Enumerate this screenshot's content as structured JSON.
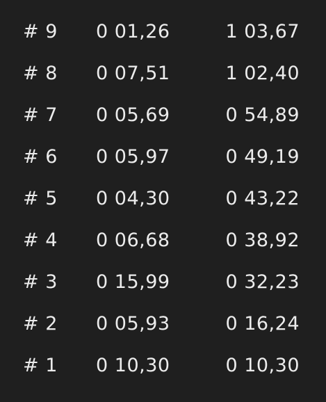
{
  "laps": [
    {
      "number": "# 9",
      "lap_time": "0 01,26",
      "total_time": "1 03,67"
    },
    {
      "number": "# 8",
      "lap_time": "0 07,51",
      "total_time": "1 02,40"
    },
    {
      "number": "# 7",
      "lap_time": "0 05,69",
      "total_time": "0 54,89"
    },
    {
      "number": "# 6",
      "lap_time": "0 05,97",
      "total_time": "0 49,19"
    },
    {
      "number": "# 5",
      "lap_time": "0 04,30",
      "total_time": "0 43,22"
    },
    {
      "number": "# 4",
      "lap_time": "0 06,68",
      "total_time": "0 38,92"
    },
    {
      "number": "# 3",
      "lap_time": "0 15,99",
      "total_time": "0 32,23"
    },
    {
      "number": "# 2",
      "lap_time": "0 05,93",
      "total_time": "0 16,24"
    },
    {
      "number": "# 1",
      "lap_time": "0 10,30",
      "total_time": "0 10,30"
    }
  ]
}
